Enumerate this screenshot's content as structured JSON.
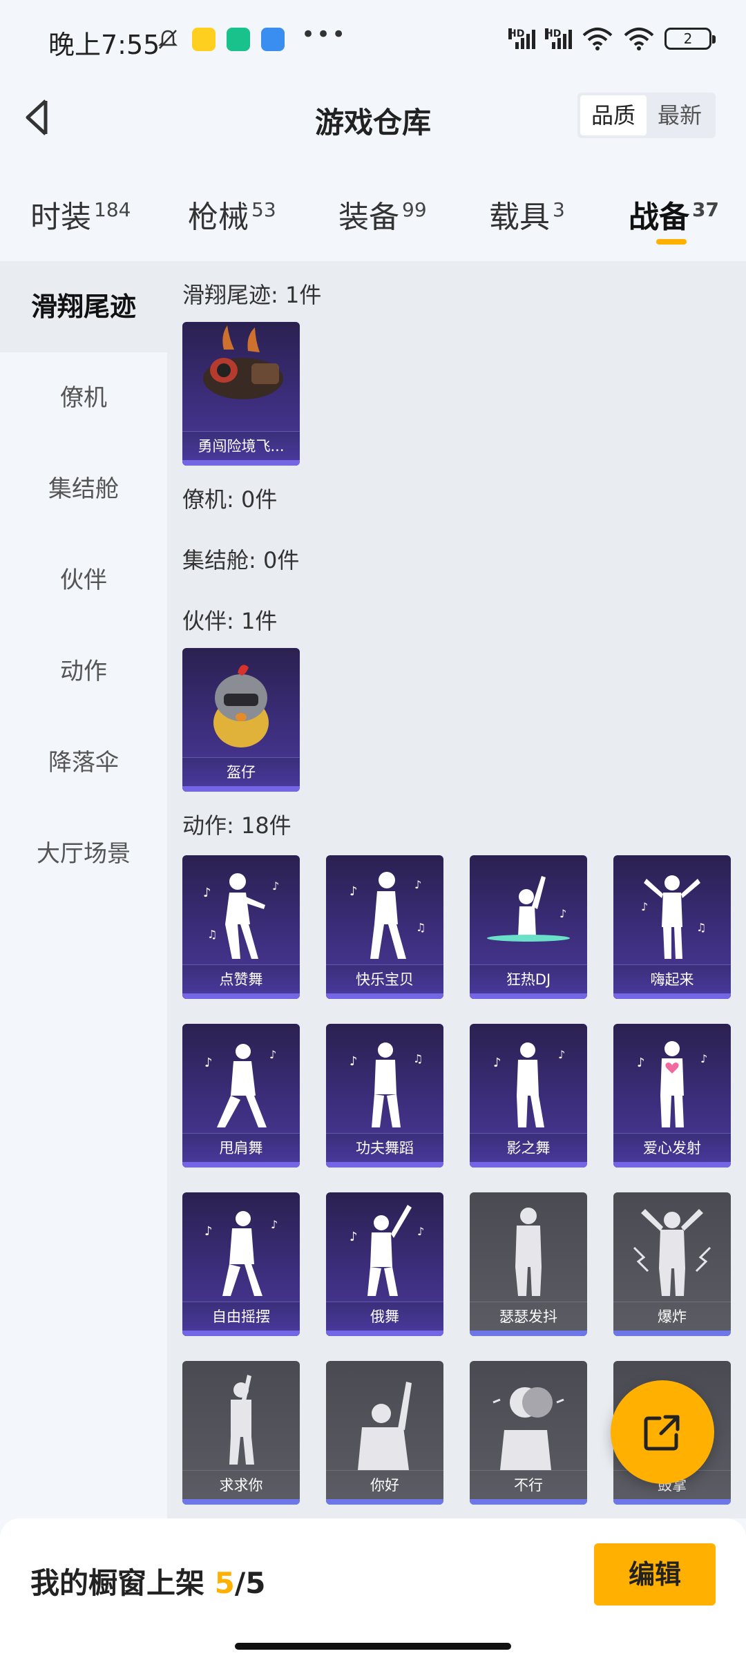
{
  "status_bar": {
    "time": "晚上7:55",
    "battery": "2"
  },
  "header": {
    "title": "游戏仓库",
    "sort_options": [
      "品质",
      "最新"
    ],
    "sort_selected": "品质"
  },
  "tabs": [
    {
      "label": "时装",
      "count": "184"
    },
    {
      "label": "枪械",
      "count": "53"
    },
    {
      "label": "装备",
      "count": "99"
    },
    {
      "label": "载具",
      "count": "3"
    },
    {
      "label": "战备",
      "count": "37"
    }
  ],
  "sidebar": {
    "items": [
      {
        "label": "滑翔尾迹"
      },
      {
        "label": "僚机"
      },
      {
        "label": "集结舱"
      },
      {
        "label": "伙伴"
      },
      {
        "label": "动作"
      },
      {
        "label": "降落伞"
      },
      {
        "label": "大厅场景"
      }
    ]
  },
  "sections": {
    "glide": {
      "title": "滑翔尾迹: 1件",
      "items": [
        "勇闯险境飞..."
      ]
    },
    "wingman": {
      "title": "僚机: 0件"
    },
    "pod": {
      "title": "集结舱: 0件"
    },
    "partner": {
      "title": "伙伴: 1件",
      "items": [
        "盔仔"
      ]
    },
    "emotes": {
      "title": "动作: 18件",
      "items": [
        "点赞舞",
        "快乐宝贝",
        "狂热DJ",
        "嗨起来",
        "甩肩舞",
        "功夫舞蹈",
        "影之舞",
        "爱心发射",
        "自由摇摆",
        "俄舞",
        "瑟瑟发抖",
        "爆炸",
        "求求你",
        "你好",
        "不行",
        "鼓掌"
      ]
    }
  },
  "bottom_bar": {
    "label": "我的橱窗上架",
    "current": "5",
    "total": "/5",
    "edit_label": "编辑"
  },
  "colors": {
    "accent": "#ffb000",
    "card_purple": "#3e2f80",
    "card_gray": "#55565d"
  }
}
